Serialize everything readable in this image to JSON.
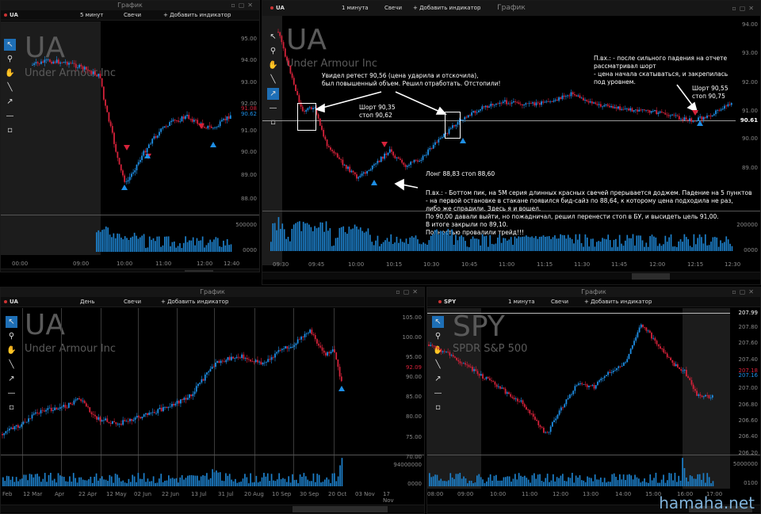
{
  "window_title": "График",
  "brand": "hamaha.net",
  "panels": {
    "tl": {
      "title": "График",
      "symbol": "UA",
      "interval": "5 минут",
      "style": "Свечи",
      "add_indicator": "+ Добавить индикатор",
      "watermark_symbol": "UA",
      "watermark_name": "Under Armour Inc",
      "price_ticks": [
        "95.00",
        "94.00",
        "93.00",
        "92.00",
        "91.00",
        "90.00",
        "89.00",
        "88.00"
      ],
      "price_tags": [
        "91.08",
        "90.62"
      ],
      "volume_ticks": [
        "500000",
        "0000"
      ],
      "time_ticks": [
        "00:00",
        "09:00",
        "10:00",
        "11:00",
        "12:00",
        "12:40"
      ]
    },
    "tr": {
      "title": "График",
      "symbol": "UA",
      "interval": "1 минута",
      "style": "Свечи",
      "add_indicator": "+ Добавить индикатор",
      "watermark_symbol": "UA",
      "watermark_name": "Under Armour Inc",
      "price_ticks": [
        "94.00",
        "93.00",
        "92.00",
        "91.00",
        "90.61",
        "90.00",
        "89.00"
      ],
      "volume_ticks": [
        "200000",
        "0000"
      ],
      "time_ticks": [
        "09:30",
        "09:45",
        "10:00",
        "10:15",
        "10:30",
        "10:45",
        "11:00",
        "11:15",
        "11:30",
        "11:45",
        "12:00",
        "12:15",
        "12:30"
      ],
      "annotations": {
        "retest": [
          "Увидел ретест 90,56 (цена ударила и отскочила),",
          "был повышенный объем. Решил отработать.  Отстопили!"
        ],
        "short1": [
          "Шорт 90,35",
          "стоп 90,62"
        ],
        "long1": "Лонг 88,83       стоп 88,60",
        "entry_right": [
          "П.вх.:  -  после сильного падения на отчете",
          "              рассматривал шорт",
          "         -  цена начала скатываться, и закрепилась",
          "              под уровнем."
        ],
        "short2": [
          "Шорт 90,55",
          "стоп 90,75"
        ],
        "entry_bottom": [
          "П.вх.:  -  Боттом пик, на 5М серия длинных красных свечей прерывается доджем. Падение на 5 пунктов",
          "           -  на первой остановке в стакане появился бид-сайз по 88,64, к которому цена подходила не раз,",
          "              либо же спрадили. Здесь я и вошел.",
          "По 90,00 давали выйти, но пожадничал, решил перенести стоп в БУ, и высидеть цель 91,00.",
          "В итоге закрыли по 89,10.",
          "Полностью провалили трейд!!!"
        ]
      }
    },
    "bl": {
      "title": "График",
      "symbol": "UA",
      "interval": "День",
      "style": "Свечи",
      "add_indicator": "+ Добавить индикатор",
      "watermark_symbol": "UA",
      "watermark_name": "Under Armour Inc",
      "price_ticks": [
        "105.00",
        "100.00",
        "95.00",
        "92.09",
        "90.00",
        "85.00",
        "80.00",
        "75.00",
        "70.00"
      ],
      "volume_ticks": [
        "94000000",
        "0000"
      ],
      "time_ticks": [
        "Feb",
        "12 Mar",
        "Apr",
        "22 Apr",
        "12 May",
        "02 Jun",
        "22 Jun",
        "13 Jul",
        "31 Jul",
        "20 Aug",
        "10 Sep",
        "30 Sep",
        "20 Oct",
        "03 Nov",
        "17 Nov"
      ]
    },
    "br": {
      "title": "График",
      "symbol": "SPY",
      "interval": "1 минута",
      "style": "Свечи",
      "add_indicator": "+ Добавить индикатор",
      "watermark_symbol": "SPY",
      "watermark_name": "SPDR S&P 500",
      "price_ticks": [
        "207.99",
        "207.80",
        "207.60",
        "207.40",
        "207.20",
        "207.00",
        "206.80",
        "206.60",
        "206.40",
        "206.20"
      ],
      "price_tags": [
        "207.18",
        "207.16"
      ],
      "volume_ticks": [
        "5000000",
        "0100"
      ],
      "time_ticks": [
        "08:00",
        "09:00",
        "10:00",
        "11:00",
        "12:00",
        "13:00",
        "14:00",
        "15:00",
        "16:00",
        "17:00"
      ]
    }
  }
}
